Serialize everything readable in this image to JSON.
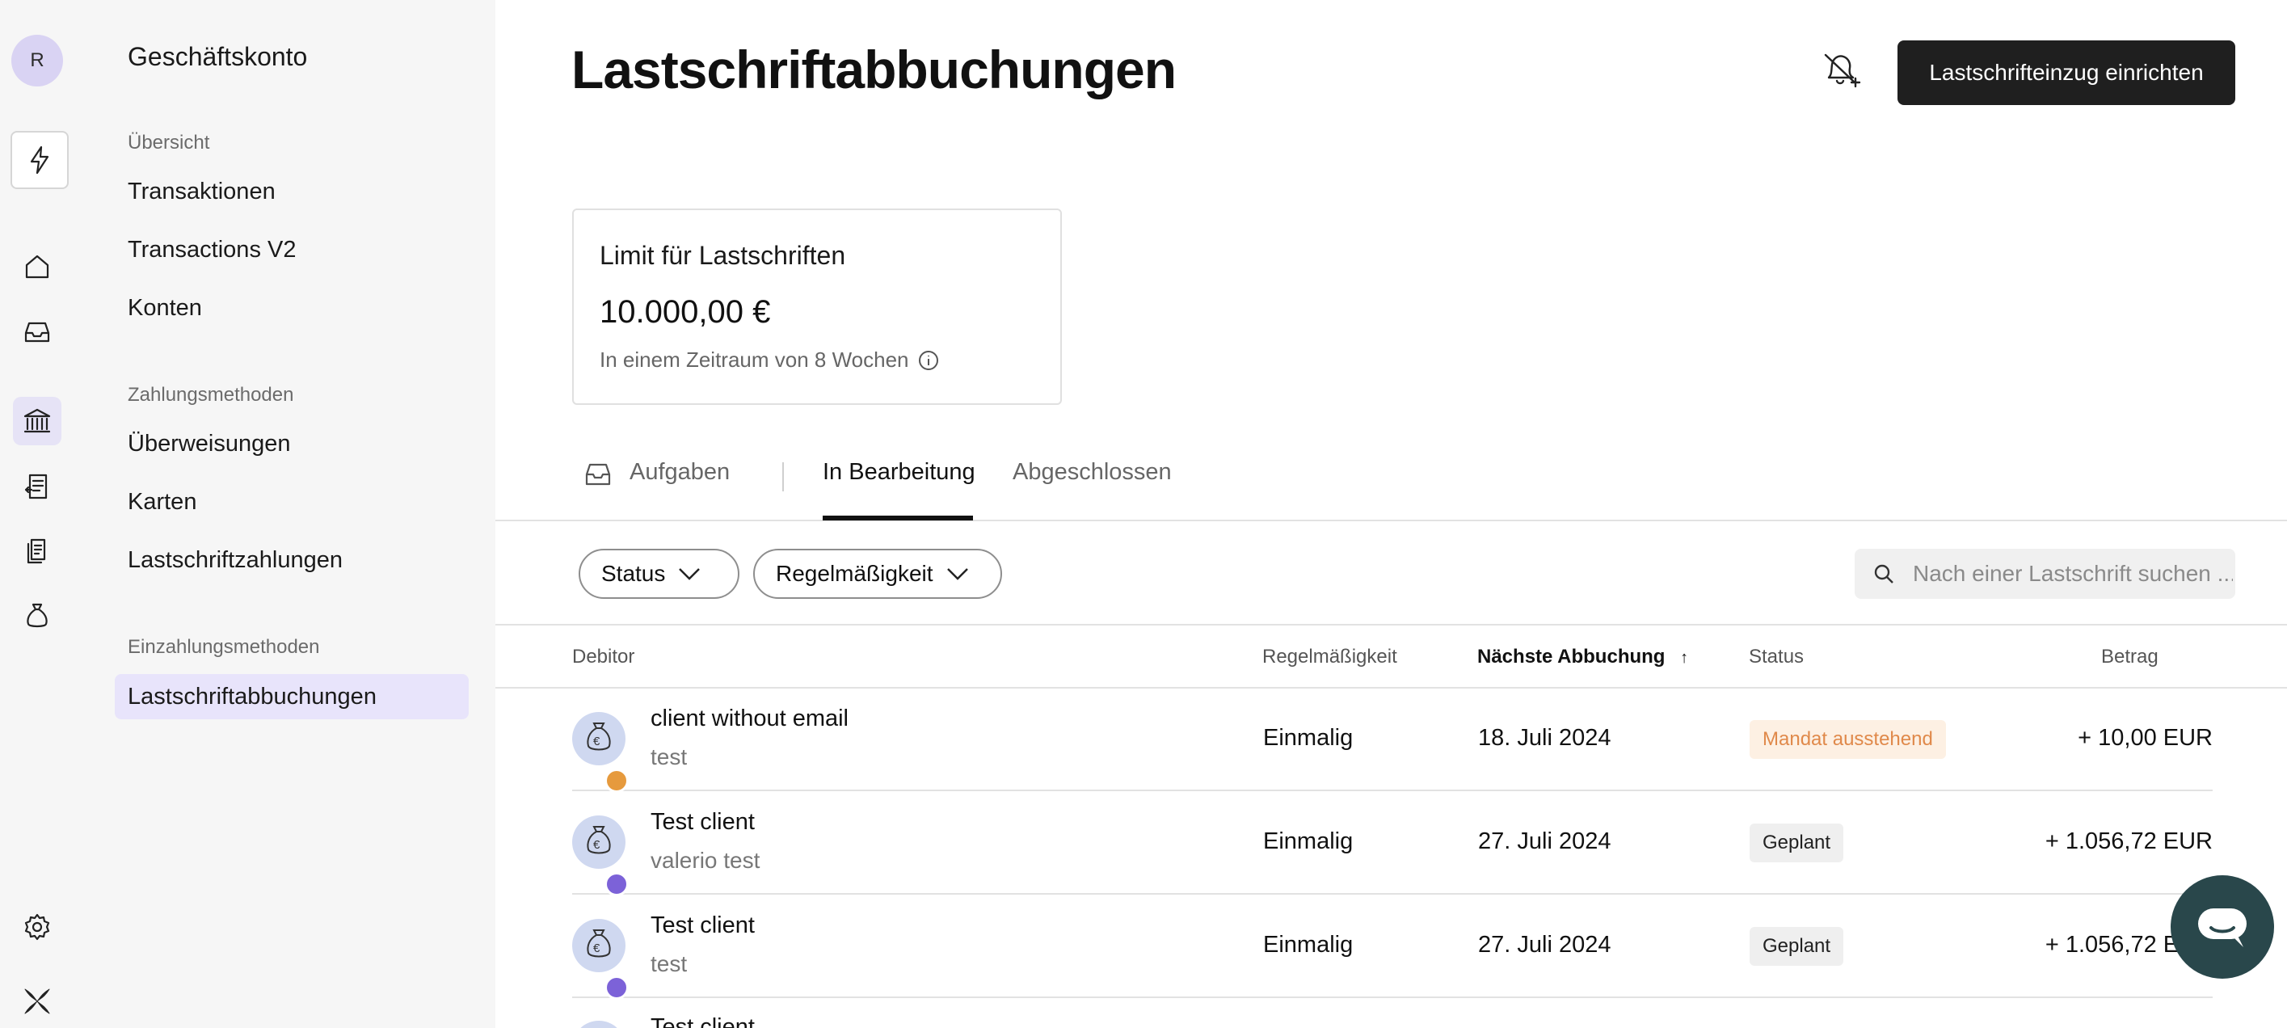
{
  "rail": {
    "avatar_initial": "R",
    "icons": [
      "lightning-icon",
      "home-icon",
      "inbox-icon",
      "bank-icon",
      "invoice-icon",
      "documents-icon",
      "money-bag-icon",
      "settings-icon",
      "brand-logo-icon"
    ],
    "active": "bank-icon"
  },
  "sidebar": {
    "account": "Geschäftskonto",
    "sections": [
      {
        "label": "Übersicht",
        "items": [
          "Transaktionen",
          "Transactions V2",
          "Konten"
        ]
      },
      {
        "label": "Zahlungsmethoden",
        "items": [
          "Überweisungen",
          "Karten",
          "Lastschriftzahlungen"
        ]
      },
      {
        "label": "Einzahlungsmethoden",
        "items": [
          "Lastschriftabbuchungen"
        ]
      }
    ],
    "active_item": "Lastschriftabbuchungen"
  },
  "header": {
    "title": "Lastschriftabbuchungen",
    "cta_label": "Lastschrifteinzug einrichten"
  },
  "limit": {
    "title": "Limit für Lastschriften",
    "value": "10.000,00 €",
    "subtitle": "In einem Zeitraum von 8 Wochen"
  },
  "tabs": [
    {
      "label": "Aufgaben",
      "active": false
    },
    {
      "label": "In Bearbeitung",
      "active": true
    },
    {
      "label": "Abgeschlossen",
      "active": false
    }
  ],
  "filters": {
    "status_label": "Status",
    "frequency_label": "Regelmäßigkeit",
    "search_placeholder": "Nach einer Lastschrift suchen ..."
  },
  "table": {
    "columns": {
      "debtor": "Debitor",
      "frequency": "Regelmäßigkeit",
      "next_debit": "Nächste Abbuchung",
      "status": "Status",
      "amount": "Betrag"
    },
    "sort": {
      "column": "next_debit",
      "direction": "ascending"
    },
    "rows": [
      {
        "name": "client without email",
        "sub": "test",
        "frequency": "Einmalig",
        "date": "18. Juli 2024",
        "status": "Mandat ausstehend",
        "status_type": "pending",
        "badge": "warning-icon",
        "amount": "+ 10,00 EUR"
      },
      {
        "name": "Test client",
        "sub": "valerio test",
        "frequency": "Einmalig",
        "date": "27. Juli 2024",
        "status": "Geplant",
        "status_type": "planned",
        "badge": "clock-icon",
        "amount": "+ 1.056,72 EUR"
      },
      {
        "name": "Test client",
        "sub": "test",
        "frequency": "Einmalig",
        "date": "27. Juli 2024",
        "status": "Geplant",
        "status_type": "planned",
        "badge": "clock-icon",
        "amount": "+ 1.056,72 EUR"
      },
      {
        "name": "Test client",
        "sub": "",
        "frequency": "",
        "date": "",
        "status": "",
        "status_type": "",
        "badge": "",
        "amount": ""
      }
    ]
  },
  "colors": {
    "accent": "#e8e4fb",
    "cta_bg": "#1f1f1f",
    "pending_bg": "#fdf0e3",
    "pending_text": "#e0894a",
    "chat_bg": "#29474b"
  }
}
